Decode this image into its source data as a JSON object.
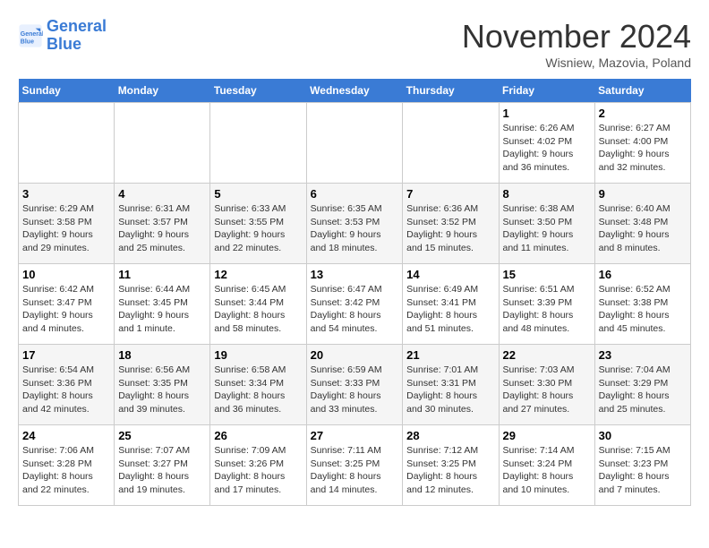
{
  "logo": {
    "line1": "General",
    "line2": "Blue"
  },
  "title": "November 2024",
  "subtitle": "Wisniew, Mazovia, Poland",
  "weekdays": [
    "Sunday",
    "Monday",
    "Tuesday",
    "Wednesday",
    "Thursday",
    "Friday",
    "Saturday"
  ],
  "weeks": [
    [
      {
        "day": "",
        "info": ""
      },
      {
        "day": "",
        "info": ""
      },
      {
        "day": "",
        "info": ""
      },
      {
        "day": "",
        "info": ""
      },
      {
        "day": "",
        "info": ""
      },
      {
        "day": "1",
        "info": "Sunrise: 6:26 AM\nSunset: 4:02 PM\nDaylight: 9 hours and 36 minutes."
      },
      {
        "day": "2",
        "info": "Sunrise: 6:27 AM\nSunset: 4:00 PM\nDaylight: 9 hours and 32 minutes."
      }
    ],
    [
      {
        "day": "3",
        "info": "Sunrise: 6:29 AM\nSunset: 3:58 PM\nDaylight: 9 hours and 29 minutes."
      },
      {
        "day": "4",
        "info": "Sunrise: 6:31 AM\nSunset: 3:57 PM\nDaylight: 9 hours and 25 minutes."
      },
      {
        "day": "5",
        "info": "Sunrise: 6:33 AM\nSunset: 3:55 PM\nDaylight: 9 hours and 22 minutes."
      },
      {
        "day": "6",
        "info": "Sunrise: 6:35 AM\nSunset: 3:53 PM\nDaylight: 9 hours and 18 minutes."
      },
      {
        "day": "7",
        "info": "Sunrise: 6:36 AM\nSunset: 3:52 PM\nDaylight: 9 hours and 15 minutes."
      },
      {
        "day": "8",
        "info": "Sunrise: 6:38 AM\nSunset: 3:50 PM\nDaylight: 9 hours and 11 minutes."
      },
      {
        "day": "9",
        "info": "Sunrise: 6:40 AM\nSunset: 3:48 PM\nDaylight: 9 hours and 8 minutes."
      }
    ],
    [
      {
        "day": "10",
        "info": "Sunrise: 6:42 AM\nSunset: 3:47 PM\nDaylight: 9 hours and 4 minutes."
      },
      {
        "day": "11",
        "info": "Sunrise: 6:44 AM\nSunset: 3:45 PM\nDaylight: 9 hours and 1 minute."
      },
      {
        "day": "12",
        "info": "Sunrise: 6:45 AM\nSunset: 3:44 PM\nDaylight: 8 hours and 58 minutes."
      },
      {
        "day": "13",
        "info": "Sunrise: 6:47 AM\nSunset: 3:42 PM\nDaylight: 8 hours and 54 minutes."
      },
      {
        "day": "14",
        "info": "Sunrise: 6:49 AM\nSunset: 3:41 PM\nDaylight: 8 hours and 51 minutes."
      },
      {
        "day": "15",
        "info": "Sunrise: 6:51 AM\nSunset: 3:39 PM\nDaylight: 8 hours and 48 minutes."
      },
      {
        "day": "16",
        "info": "Sunrise: 6:52 AM\nSunset: 3:38 PM\nDaylight: 8 hours and 45 minutes."
      }
    ],
    [
      {
        "day": "17",
        "info": "Sunrise: 6:54 AM\nSunset: 3:36 PM\nDaylight: 8 hours and 42 minutes."
      },
      {
        "day": "18",
        "info": "Sunrise: 6:56 AM\nSunset: 3:35 PM\nDaylight: 8 hours and 39 minutes."
      },
      {
        "day": "19",
        "info": "Sunrise: 6:58 AM\nSunset: 3:34 PM\nDaylight: 8 hours and 36 minutes."
      },
      {
        "day": "20",
        "info": "Sunrise: 6:59 AM\nSunset: 3:33 PM\nDaylight: 8 hours and 33 minutes."
      },
      {
        "day": "21",
        "info": "Sunrise: 7:01 AM\nSunset: 3:31 PM\nDaylight: 8 hours and 30 minutes."
      },
      {
        "day": "22",
        "info": "Sunrise: 7:03 AM\nSunset: 3:30 PM\nDaylight: 8 hours and 27 minutes."
      },
      {
        "day": "23",
        "info": "Sunrise: 7:04 AM\nSunset: 3:29 PM\nDaylight: 8 hours and 25 minutes."
      }
    ],
    [
      {
        "day": "24",
        "info": "Sunrise: 7:06 AM\nSunset: 3:28 PM\nDaylight: 8 hours and 22 minutes."
      },
      {
        "day": "25",
        "info": "Sunrise: 7:07 AM\nSunset: 3:27 PM\nDaylight: 8 hours and 19 minutes."
      },
      {
        "day": "26",
        "info": "Sunrise: 7:09 AM\nSunset: 3:26 PM\nDaylight: 8 hours and 17 minutes."
      },
      {
        "day": "27",
        "info": "Sunrise: 7:11 AM\nSunset: 3:25 PM\nDaylight: 8 hours and 14 minutes."
      },
      {
        "day": "28",
        "info": "Sunrise: 7:12 AM\nSunset: 3:25 PM\nDaylight: 8 hours and 12 minutes."
      },
      {
        "day": "29",
        "info": "Sunrise: 7:14 AM\nSunset: 3:24 PM\nDaylight: 8 hours and 10 minutes."
      },
      {
        "day": "30",
        "info": "Sunrise: 7:15 AM\nSunset: 3:23 PM\nDaylight: 8 hours and 7 minutes."
      }
    ]
  ]
}
